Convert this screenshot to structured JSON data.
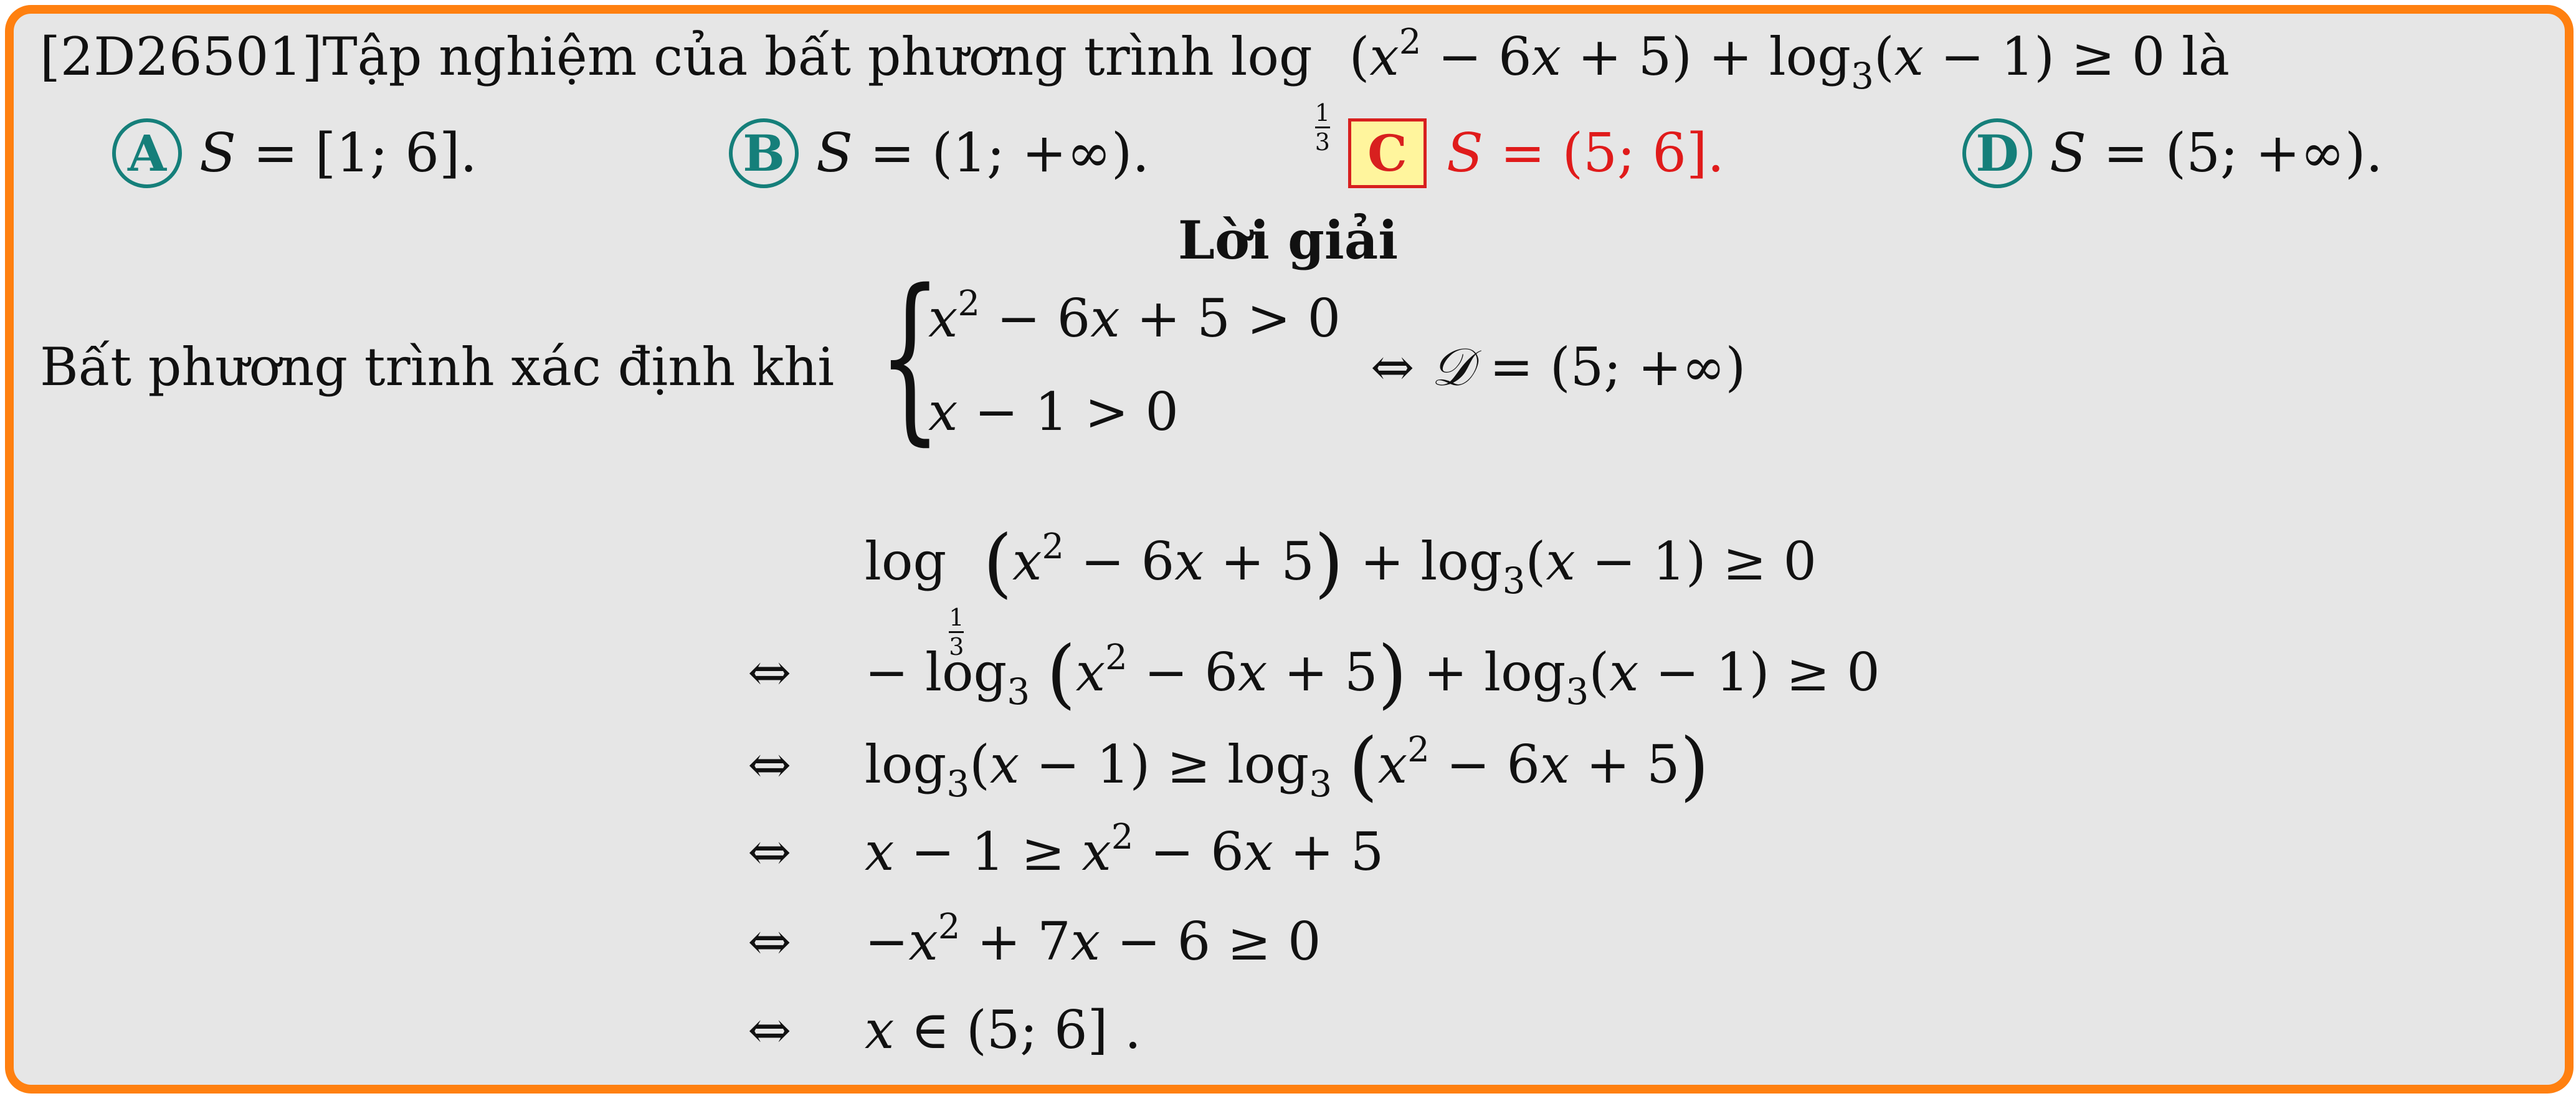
{
  "question": {
    "code": "[2D26501]",
    "text": "Tập nghiệm của bất phương trình",
    "expr": "log 1/3 (x² − 6x + 5) + log3(x − 1) ≥ 0",
    "tail": "là"
  },
  "options": [
    {
      "letter": "A",
      "text": "S = [1; 6]."
    },
    {
      "letter": "B",
      "text": "S = (1; +∞)."
    },
    {
      "letter": "C",
      "text": "S = (5; 6].",
      "correct": true
    },
    {
      "letter": "D",
      "text": "S = (5; +∞)."
    }
  ],
  "solution": {
    "title": "Lời giải",
    "condition_label": "Bất phương trình xác định khi",
    "conditions": [
      "x² − 6x + 5 > 0",
      "x − 1 > 0"
    ],
    "domain": "⇔ 𝒟 = (5; +∞)",
    "steps": [
      {
        "arrow": "",
        "expr": "log 1/3 (x² − 6x + 5) + log3(x − 1) ≥ 0"
      },
      {
        "arrow": "⇔",
        "expr": "− log3 (x² − 6x + 5) + log3(x − 1) ≥ 0"
      },
      {
        "arrow": "⇔",
        "expr": "log3(x − 1) ≥ log3 (x² − 6x + 5)"
      },
      {
        "arrow": "⇔",
        "expr": "x − 1 ≥ x² − 6x + 5"
      },
      {
        "arrow": "⇔",
        "expr": "−x² + 7x − 6 ≥ 0"
      },
      {
        "arrow": "⇔",
        "expr": "x ∈ (5; 6] ."
      }
    ]
  },
  "colors": {
    "border": "#ff8010",
    "background": "#e6e6e6",
    "option_circle": "#157f7a",
    "correct": "#e01b1b",
    "correct_box_fill": "#fff59d"
  }
}
